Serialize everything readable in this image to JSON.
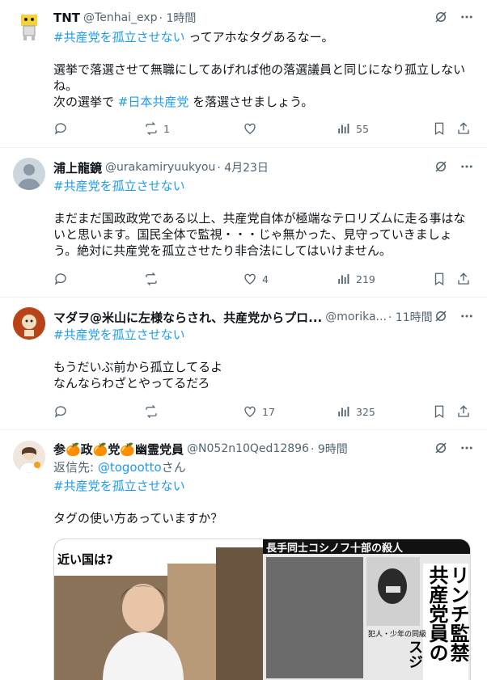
{
  "tweets": [
    {
      "name": "TNT",
      "handle": "@Tenhai_exp",
      "time": "· 1時間",
      "lines": [
        [
          {
            "t": "#共産党を孤立させない",
            "tag": true
          },
          {
            "t": " ってアホなタグあるなー。",
            "tag": false
          }
        ],
        [],
        [
          {
            "t": "選挙で落選させて無職にしてあげれば他の落選議員と同じになり孤立しない",
            "tag": false
          }
        ],
        [
          {
            "t": "ね。",
            "tag": false
          }
        ],
        [
          {
            "t": "次の選挙で ",
            "tag": false
          },
          {
            "t": "#日本共産党",
            "tag": true
          },
          {
            "t": " を落選させましょう。",
            "tag": false
          }
        ]
      ],
      "replies": "",
      "retweets": "1",
      "likes": "",
      "views": "55"
    },
    {
      "name": "浦上龍鏡",
      "handle": "@urakamiryuukyou",
      "time": "· 4月23日",
      "lines": [
        [
          {
            "t": "#共産党を孤立させない",
            "tag": true
          }
        ],
        [],
        [
          {
            "t": "まだまだ国政政党である以上、共産党自体が極端なテロリズムに走る事はな",
            "tag": false
          }
        ],
        [
          {
            "t": "いと思います。国民全体で監視・・・じゃ無かった、見守っていきましょ",
            "tag": false
          }
        ],
        [
          {
            "t": "う。絶対に共産党を孤立させたり非合法にしてはいけません。",
            "tag": false
          }
        ]
      ],
      "replies": "",
      "retweets": "",
      "likes": "4",
      "views": "219"
    },
    {
      "name": "マダヲ@米山に左様ならされ、共産党からプロ...",
      "handle": "@morika...",
      "time": "· 11時間",
      "lines": [
        [
          {
            "t": "#共産党を孤立させない",
            "tag": true
          }
        ],
        [],
        [
          {
            "t": "もうだいぶ前から孤立してるよ",
            "tag": false
          }
        ],
        [
          {
            "t": "なんならわざとやってるだろ",
            "tag": false
          }
        ]
      ],
      "replies": "",
      "retweets": "",
      "likes": "17",
      "views": "325"
    },
    {
      "name": "参🍊政🍊党🍊幽霊党員",
      "handle": "@N052n10Qed12896",
      "time": "· 9時間",
      "reply_to_prefix": "返信先: ",
      "reply_to": "@togootto",
      "reply_to_suffix": "さん",
      "lines": [
        [
          {
            "t": "#共産党を孤立させない",
            "tag": true
          }
        ],
        [],
        [
          {
            "t": "タグの使い方あっていますか？",
            "tag": false
          }
        ]
      ],
      "media_left_caption": "近い国は?",
      "media_right_headline": "リンチ監禁",
      "media_right_sub": "共産党員の",
      "media_right_top": "長手同士コシノフ十部の殺人",
      "media_right_small": "スジ",
      "media_photo_caption": "犯人・少年の同級"
    }
  ],
  "colors": {
    "accent": "#1d9bf0",
    "muted": "#536471",
    "border": "#eff3f4"
  },
  "icons": [
    "grok-icon",
    "more-icon",
    "reply-icon",
    "retweet-icon",
    "like-icon",
    "views-icon",
    "bookmark-icon",
    "share-icon"
  ]
}
